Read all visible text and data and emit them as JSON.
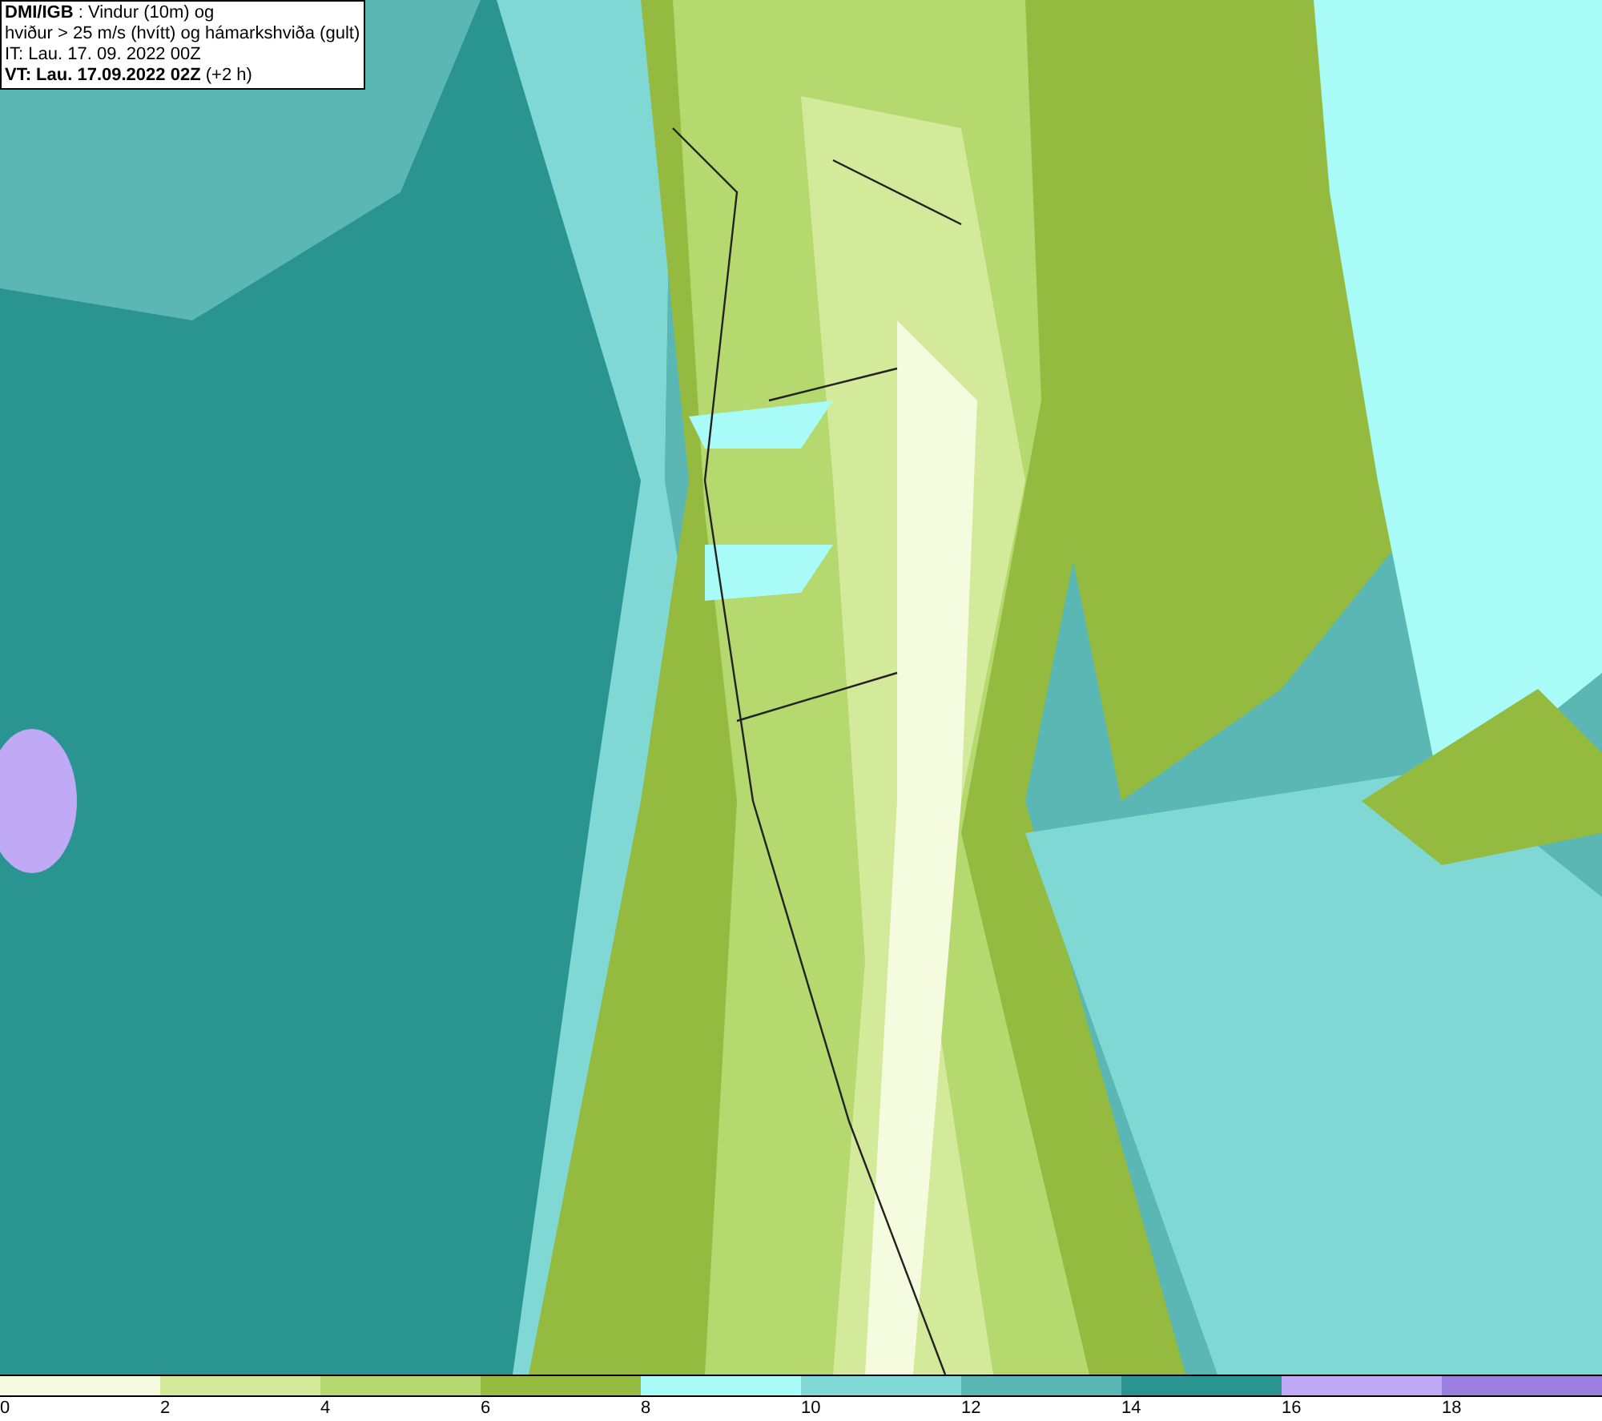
{
  "title_box": {
    "lines": [
      "**DMI/IGB** : Vindur (10m) og",
      "hviður > 25 m/s (hvítt) og hámarkshviða (gult)",
      "IT: Lau. 17. 09. 2022 00Z",
      "**VT: Lau. 17.09.2022 02Z** (+2 h)"
    ]
  },
  "legend": {
    "bins": [
      {
        "color": "#f5fbdf"
      },
      {
        "color": "#d2ea9a"
      },
      {
        "color": "#b5d96f"
      },
      {
        "color": "#94bb3f"
      },
      {
        "color": "#a8fbf7"
      },
      {
        "color": "#7fd8d4"
      },
      {
        "color": "#5bb7b3"
      },
      {
        "color": "#2a9490"
      },
      {
        "color": "#c0aaf5"
      },
      {
        "color": "#9a7fe0"
      }
    ],
    "ticks": [
      "0",
      "2",
      "4",
      "6",
      "8",
      "10",
      "12",
      "14",
      "16",
      "18"
    ]
  }
}
